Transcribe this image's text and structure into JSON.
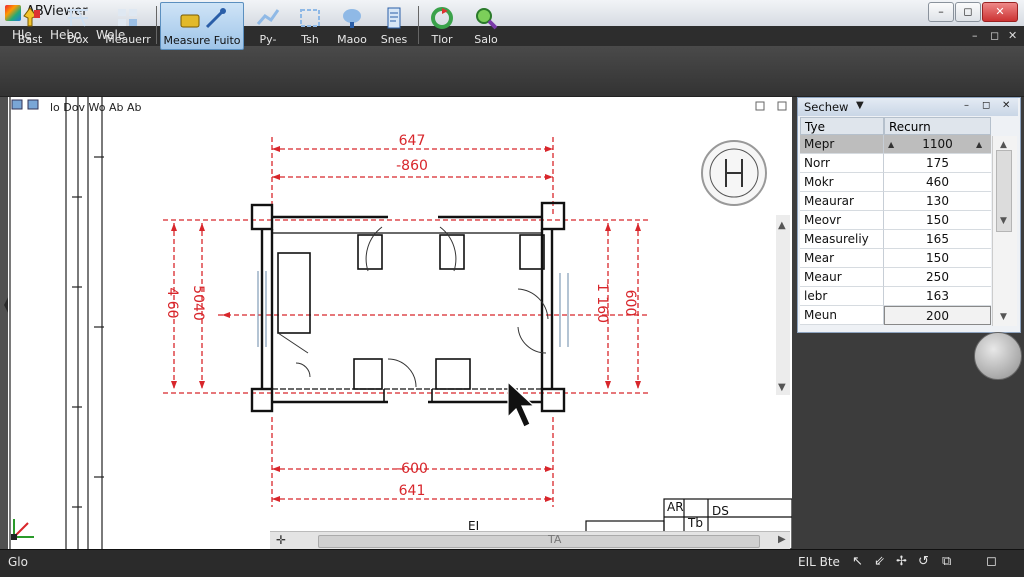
{
  "window": {
    "title": "ABViewer",
    "min": "–",
    "max": "◻",
    "close": "✕"
  },
  "menu": {
    "items": [
      "Hle",
      "Hebo",
      "Wele"
    ],
    "mdi": {
      "min": "–",
      "restore": "◻",
      "close": "✕"
    }
  },
  "toolbar": {
    "buttons": [
      {
        "label": "Bast",
        "icon": "pin-icon"
      },
      {
        "label": "Dox",
        "icon": "layers-icon"
      },
      {
        "label": "Meauerr",
        "icon": "grid-icon"
      },
      {
        "label": "Measure Fuito",
        "icon": "measure-icon"
      },
      {
        "label": "Py-",
        "icon": "polyline-icon"
      },
      {
        "label": "Tsh",
        "icon": "frame-icon"
      },
      {
        "label": "Maoo",
        "icon": "zoom-icon"
      },
      {
        "label": "Snes",
        "icon": "document-icon"
      },
      {
        "label": "Tlor",
        "icon": "refresh-icon"
      },
      {
        "label": "Salo",
        "icon": "search-icon"
      }
    ],
    "active_index": 3
  },
  "canvas": {
    "header_label": "lo Dov Wo Ab Ab",
    "dimensions": {
      "top_outer": "647",
      "top_inner": "-860",
      "bottom_inner": "-600",
      "bottom_outer": "641",
      "left_outer": "4 60",
      "left_inner": "5040",
      "right_inner": "1 160",
      "right_outer": "600"
    },
    "title_block": [
      "AR",
      "Tb",
      "DS"
    ],
    "bottom_label": "TA",
    "small_label": "EI"
  },
  "panel": {
    "title": "Sechew",
    "columns": [
      "Tye",
      "Recurn"
    ],
    "rows": [
      {
        "name": "Mepr",
        "value": "1100",
        "selected": true
      },
      {
        "name": "Norr",
        "value": "175"
      },
      {
        "name": "Mokr",
        "value": "460"
      },
      {
        "name": "Meaurar",
        "value": "130"
      },
      {
        "name": "Meovr",
        "value": "150"
      },
      {
        "name": "Measureliy",
        "value": "165"
      },
      {
        "name": "Mear",
        "value": "150"
      },
      {
        "name": "Meaur",
        "value": "250"
      },
      {
        "name": "lebr",
        "value": "163"
      },
      {
        "name": "Meun",
        "value": "200",
        "editing": true
      }
    ]
  },
  "status": {
    "left_text": "Glo",
    "right_text": "EIL Bte",
    "icons": [
      "cursor-icon",
      "arrow-icon",
      "pan-icon",
      "rotate-icon",
      "copy-icon",
      "window-icon"
    ]
  },
  "colors": {
    "dimension": "#d8262b",
    "accent_active": "#9ec4e8"
  }
}
